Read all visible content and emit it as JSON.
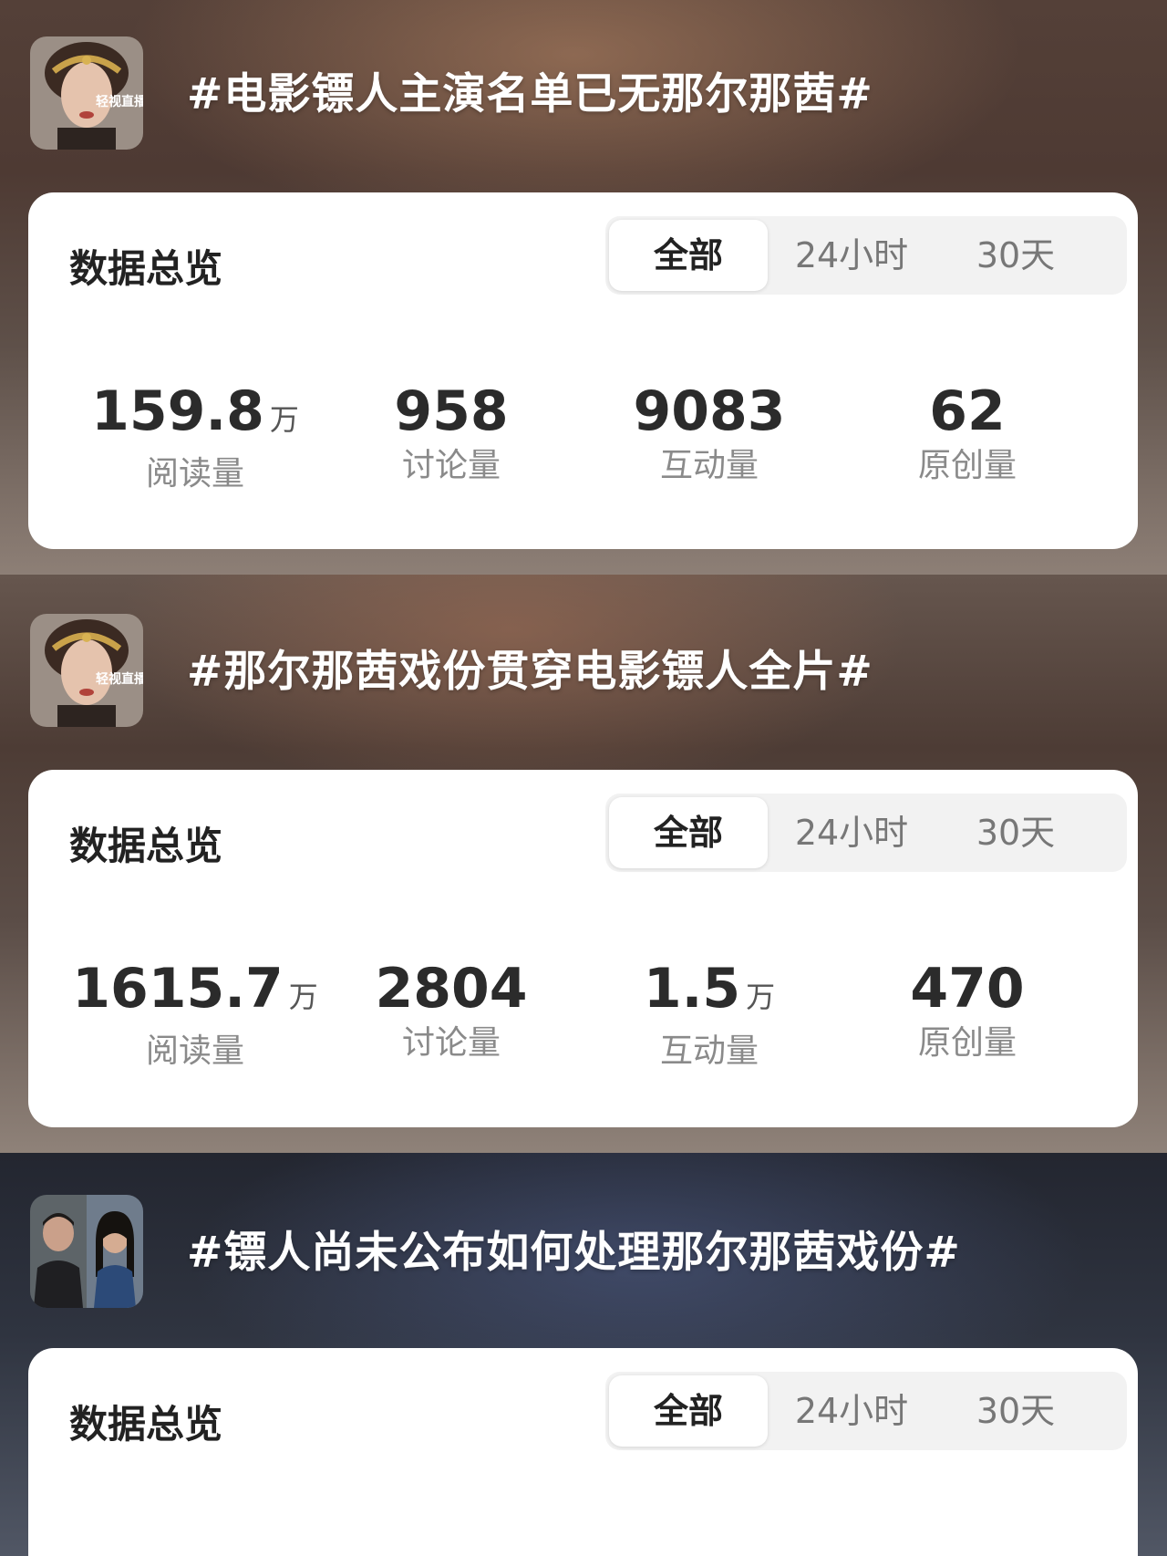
{
  "topics": [
    {
      "title": "#电影镖人主演名单已无那尔那茜#",
      "card_title": "数据总览",
      "tabs": [
        "全部",
        "24小时",
        "30天"
      ],
      "active_tab": "全部",
      "stats": [
        {
          "value": "159.8",
          "unit": "万",
          "label": "阅读量"
        },
        {
          "value": "958",
          "unit": "",
          "label": "讨论量"
        },
        {
          "value": "9083",
          "unit": "",
          "label": "互动量"
        },
        {
          "value": "62",
          "unit": "",
          "label": "原创量"
        }
      ]
    },
    {
      "title": "#那尔那茜戏份贯穿电影镖人全片#",
      "card_title": "数据总览",
      "tabs": [
        "全部",
        "24小时",
        "30天"
      ],
      "active_tab": "全部",
      "stats": [
        {
          "value": "1615.7",
          "unit": "万",
          "label": "阅读量"
        },
        {
          "value": "2804",
          "unit": "",
          "label": "讨论量"
        },
        {
          "value": "1.5",
          "unit": "万",
          "label": "互动量"
        },
        {
          "value": "470",
          "unit": "",
          "label": "原创量"
        }
      ]
    },
    {
      "title": "#镖人尚未公布如何处理那尔那茜戏份#",
      "card_title": "数据总览",
      "tabs": [
        "全部",
        "24小时",
        "30天"
      ],
      "active_tab": "全部"
    }
  ],
  "avatar_overlay_text": "轻视直播"
}
